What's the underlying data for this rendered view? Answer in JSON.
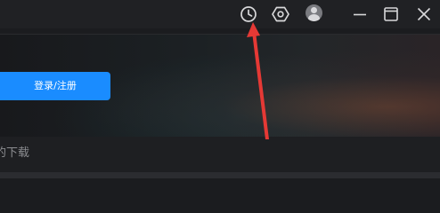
{
  "titlebar": {
    "icons": [
      "history-clock-icon",
      "settings-hex-icon",
      "user-avatar-icon"
    ],
    "window_controls": [
      "minimize-icon",
      "maximize-icon",
      "close-icon"
    ]
  },
  "banner": {
    "login_label": "登录/注册"
  },
  "sidebar": {
    "downloads_label": "的下载"
  },
  "colors": {
    "accent": "#1a8cff",
    "annotation_arrow": "#e53935",
    "titlebar_bg": "#202124",
    "icon": "#d8d8da"
  }
}
